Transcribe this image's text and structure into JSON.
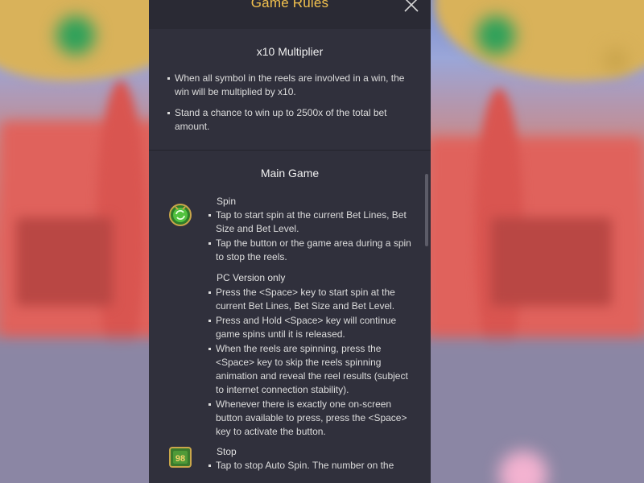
{
  "panel": {
    "title": "Game Rules",
    "close_icon": "close-icon"
  },
  "multiplier": {
    "title": "x10 Multiplier",
    "bullets": [
      "When all symbol in the reels are involved in a win, the win will be multiplied by x10.",
      "Stand a chance to win up to 2500x of the total bet amount."
    ]
  },
  "main_game": {
    "title": "Main Game",
    "spin": {
      "icon": "spin-button-icon",
      "title": "Spin",
      "bullets": [
        "Tap to start spin at the current Bet Lines, Bet Size and Bet Level.",
        "Tap the button or the game area during a spin to stop the reels."
      ],
      "pc_title": "PC Version only",
      "pc_bullets": [
        "Press the <Space> key to start spin at the current Bet Lines, Bet Size and Bet Level.",
        "Press and Hold <Space> key will continue game spins until it is released.",
        "When the reels are spinning, press the <Space> key to skip the reels spinning animation and reveal the reel results (subject to internet connection stability).",
        "Whenever there is exactly one on-screen button available to press, press the <Space> key to activate the button."
      ]
    },
    "stop": {
      "icon": "stop-button-icon",
      "icon_text": "98",
      "title": "Stop",
      "bullets": [
        "Tap to stop Auto Spin. The number on the"
      ]
    }
  },
  "colors": {
    "title_gold": "#f2c14e",
    "panel_bg": "#30303c",
    "spin_green": "#3fae3a"
  }
}
